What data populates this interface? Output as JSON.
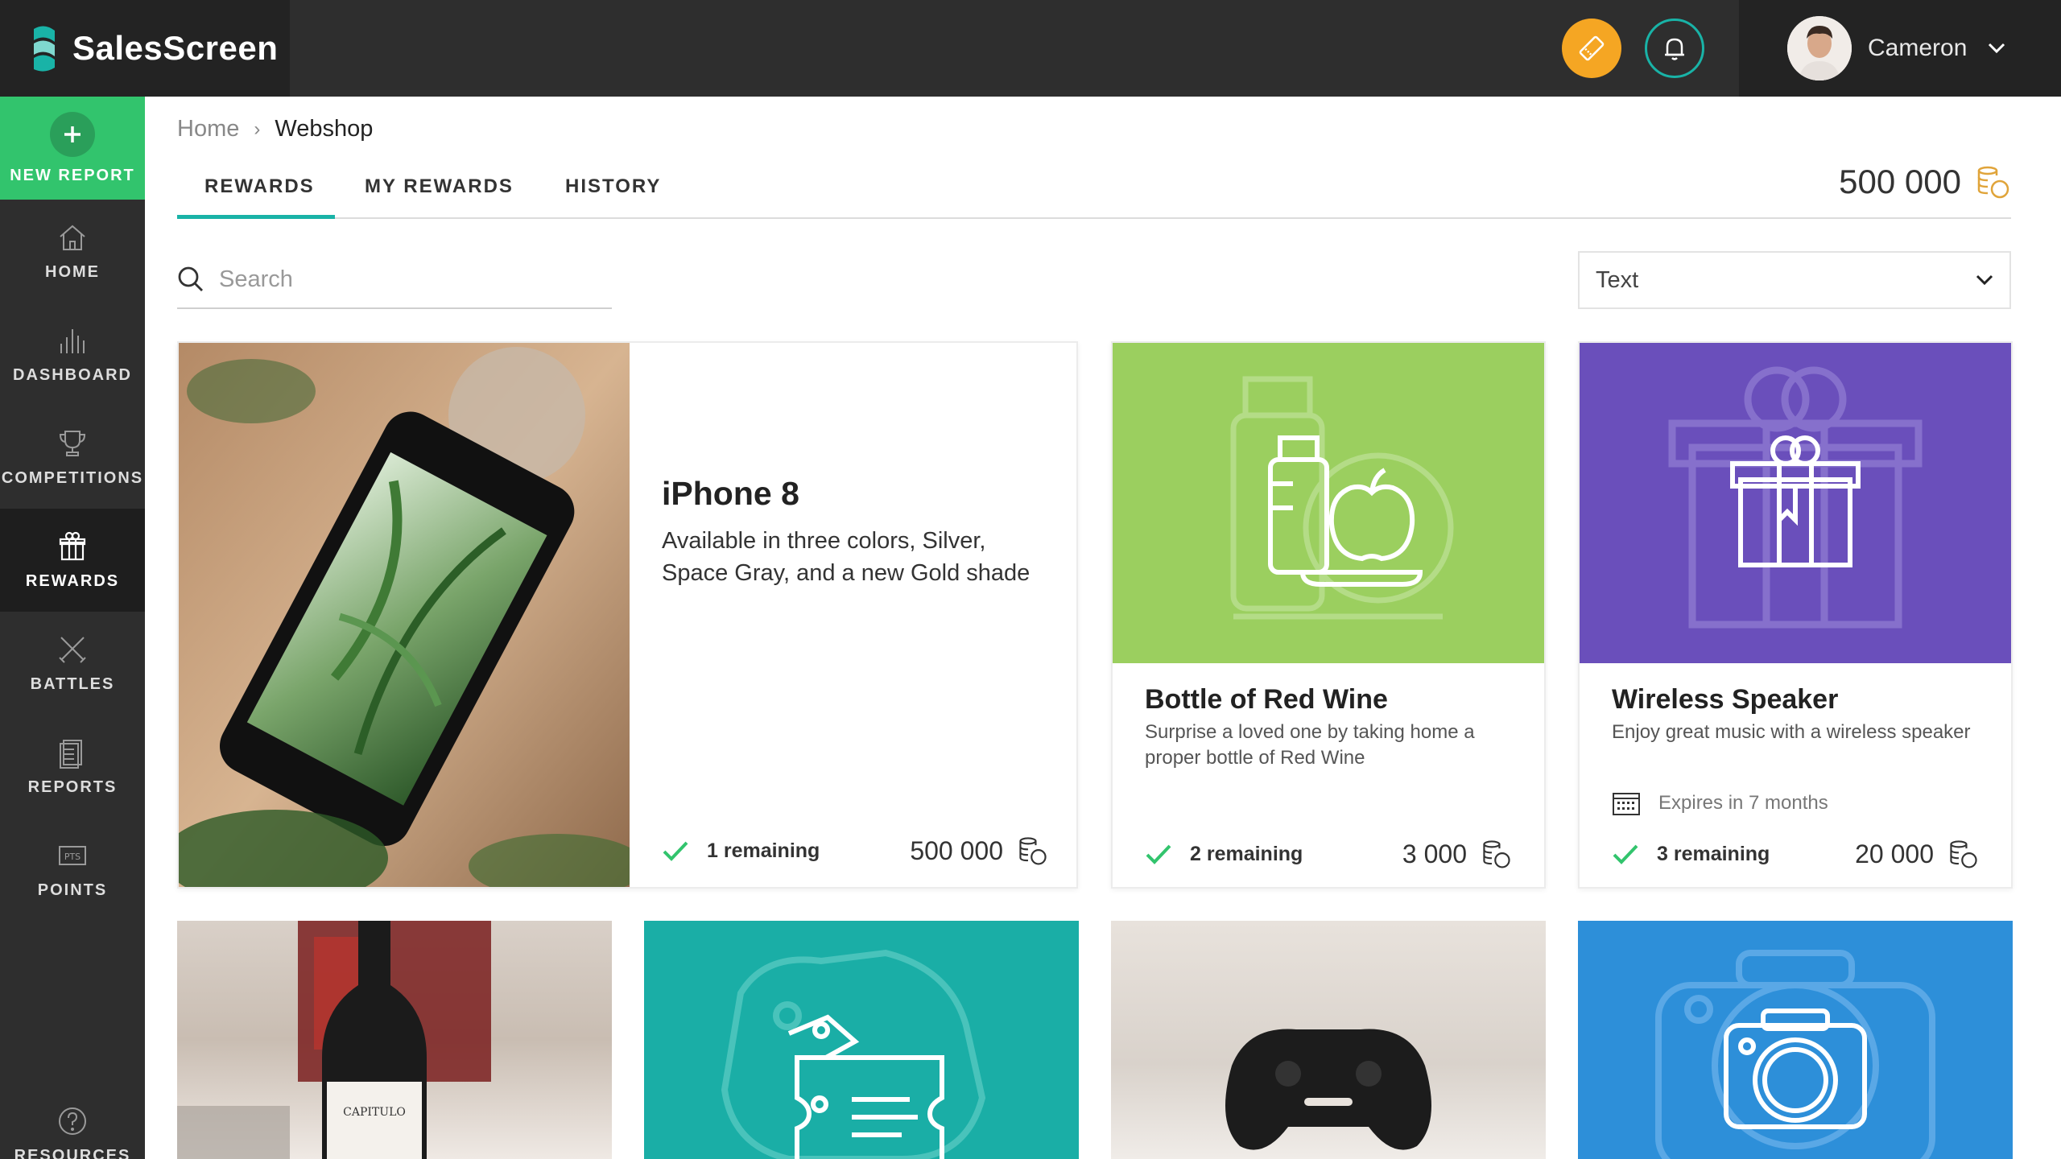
{
  "app": {
    "name": "SalesScreen"
  },
  "header": {
    "user_name": "Cameron",
    "accent_colors": {
      "ticket": "#f5a623",
      "bell": "#19b3a7"
    }
  },
  "sidebar": {
    "new_report_label": "NEW REPORT",
    "items": [
      {
        "label": "HOME",
        "icon": "home-icon"
      },
      {
        "label": "DASHBOARD",
        "icon": "bar-chart-icon"
      },
      {
        "label": "COMPETITIONS",
        "icon": "trophy-icon"
      },
      {
        "label": "REWARDS",
        "icon": "gift-icon",
        "active": true
      },
      {
        "label": "BATTLES",
        "icon": "crossed-swords-icon"
      },
      {
        "label": "REPORTS",
        "icon": "document-icon"
      },
      {
        "label": "POINTS",
        "icon": "pts-icon"
      }
    ],
    "resources_label": "RESOURCES"
  },
  "breadcrumb": {
    "home": "Home",
    "separator": "›",
    "current": "Webshop"
  },
  "tabs": [
    {
      "label": "REWARDS",
      "active": true
    },
    {
      "label": "MY REWARDS"
    },
    {
      "label": "HISTORY"
    }
  ],
  "balance": {
    "value": "500 000"
  },
  "search": {
    "placeholder": "Search",
    "value": ""
  },
  "sort_select": {
    "value": "Text"
  },
  "rewards": [
    {
      "title": "iPhone 8",
      "description": "Available in three colors, Silver, Space Gray, and a new Gold shade",
      "remaining": "1 remaining",
      "price": "500 000"
    },
    {
      "title": "Bottle of Red Wine",
      "description": "Surprise a loved one by taking home a proper bottle of Red Wine",
      "remaining": "2 remaining",
      "price": "3 000",
      "hero_color": "#9bcf5f"
    },
    {
      "title": "Wireless Speaker",
      "description": "Enjoy great music with a wireless speaker",
      "expires": "Expires in 7 months",
      "remaining": "3 remaining",
      "price": "20 000",
      "hero_color": "#6a4fbb"
    }
  ],
  "row2_tiles": [
    {
      "kind": "photo",
      "label": "CAPITULO"
    },
    {
      "kind": "icon",
      "icon": "coupon-icon",
      "color": "#1aaea6"
    },
    {
      "kind": "photo",
      "icon": "gamepad-icon"
    },
    {
      "kind": "icon",
      "icon": "camera-icon",
      "color": "#2d8fd9"
    }
  ]
}
